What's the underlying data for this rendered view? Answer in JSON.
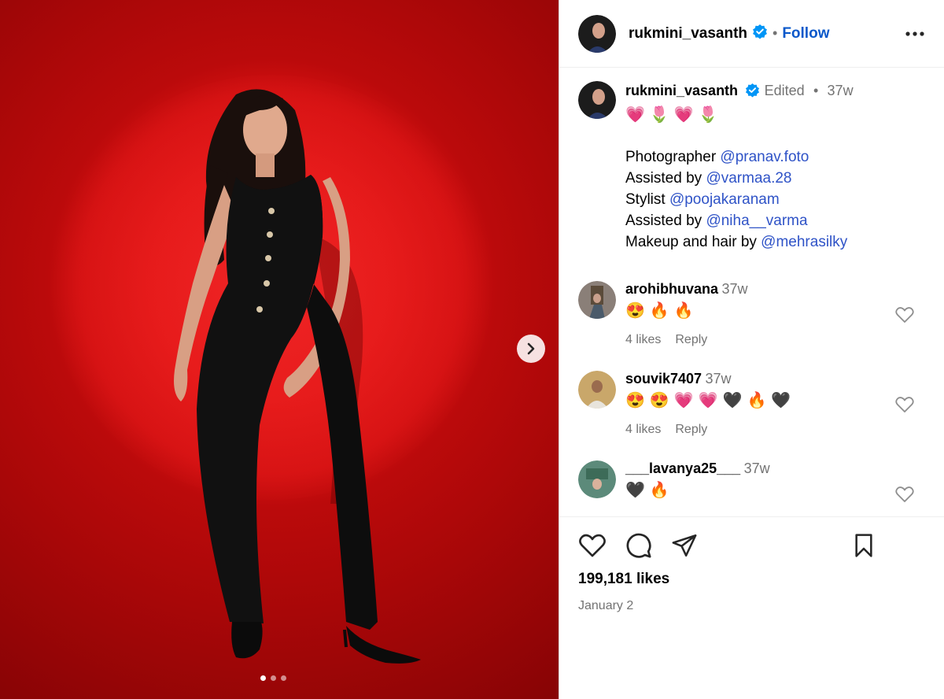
{
  "post": {
    "username": "rukmini_vasanth",
    "follow_label": "Follow",
    "separator": "•"
  },
  "caption": {
    "username": "rukmini_vasanth",
    "edited": "Edited",
    "time": "37w",
    "emojis": "💗🌷💗🌷",
    "lines": [
      {
        "text": "Photographer ",
        "mention": "@pranav.foto"
      },
      {
        "text": "Assisted by ",
        "mention": "@varmaa.28"
      },
      {
        "text": "Stylist ",
        "mention": "@poojakaranam"
      },
      {
        "text": "Assisted by ",
        "mention": "@niha__varma"
      },
      {
        "text": "Makeup and hair by ",
        "mention": "@mehrasilky"
      }
    ]
  },
  "comments": [
    {
      "username": "arohibhuvana",
      "time": "37w",
      "text": "😍🔥🔥",
      "likes": "4 likes",
      "reply": "Reply"
    },
    {
      "username": "souvik7407",
      "time": "37w",
      "text": "😍😍💗💗🖤🔥🖤",
      "likes": "4 likes",
      "reply": "Reply"
    },
    {
      "username": "___lavanya25___",
      "time": "37w",
      "text": "🖤🔥",
      "likes": "",
      "reply": ""
    }
  ],
  "footer": {
    "likes": "199,181 likes",
    "date": "January 2"
  },
  "carousel": {
    "count": 3,
    "active": 0
  },
  "colors": {
    "link": "#0a58ca",
    "verified": "#0095f6",
    "background_red": "#c40d0e"
  }
}
